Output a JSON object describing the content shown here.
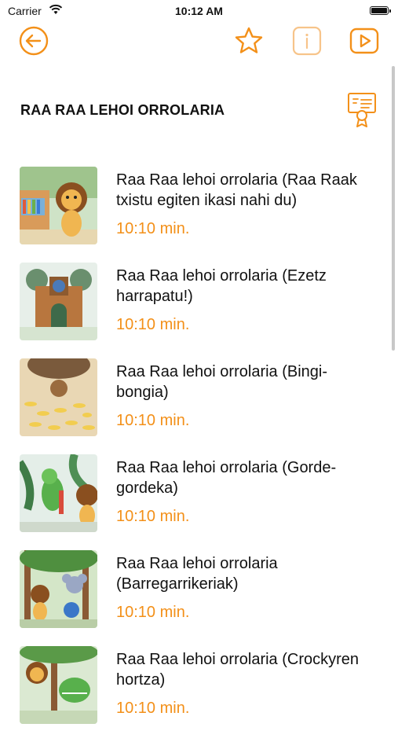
{
  "status_bar": {
    "carrier": "Carrier",
    "time": "10:12 AM"
  },
  "toolbar": {
    "icons": [
      "back-arrow-icon",
      "star-icon",
      "info-icon",
      "play-icon"
    ]
  },
  "colors": {
    "accent": "#f39019",
    "text": "#111111",
    "background": "#ffffff"
  },
  "section": {
    "title": "RAA RAA LEHOI ORROLARIA",
    "icon": "certificate-icon"
  },
  "episodes": [
    {
      "title": "Raa Raa lehoi orrolaria (Raa Raak txistu egiten ikasi nahi du)",
      "duration": "10:10 min."
    },
    {
      "title": "Raa Raa lehoi orrolaria (Ezetz harrapatu!)",
      "duration": "10:10 min."
    },
    {
      "title": "Raa Raa lehoi orrolaria (Bingi-bongia)",
      "duration": "10:10 min."
    },
    {
      "title": "Raa Raa lehoi orrolaria (Gorde-gordeka)",
      "duration": "10:10 min."
    },
    {
      "title": "Raa Raa lehoi orrolaria (Barregarrikeriak)",
      "duration": "10:10 min."
    },
    {
      "title": "Raa Raa lehoi orrolaria (Crockyren hortza)",
      "duration": "10:10 min."
    }
  ]
}
